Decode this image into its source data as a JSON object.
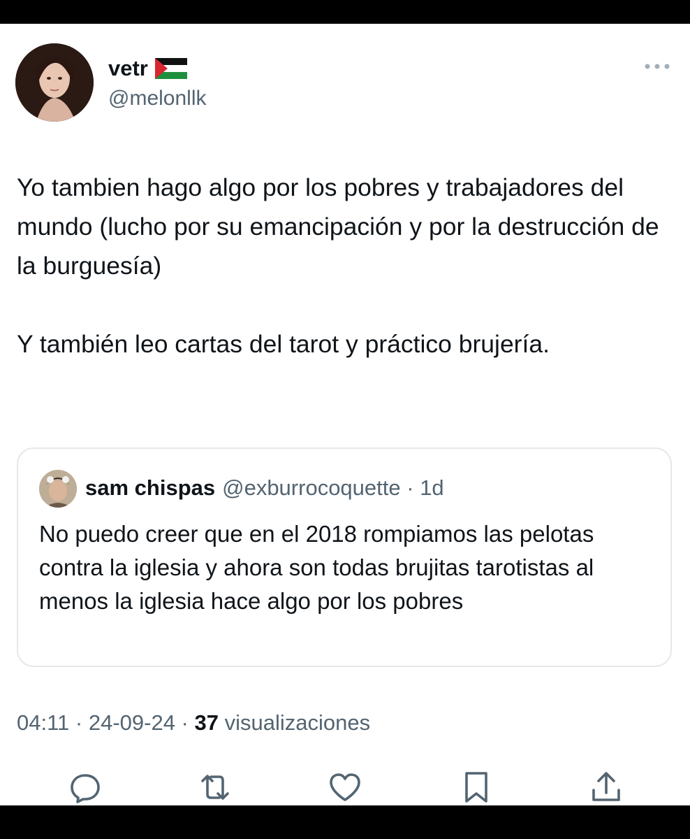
{
  "tweet": {
    "author_name": "vetr",
    "handle": "@melonllk",
    "text_paragraphs": [
      "Yo tambien hago algo por los pobres y trabajadores del mundo (lucho por su emancipación y por la destrucción de la burguesía)",
      "Y también leo cartas del tarot y práctico brujería."
    ],
    "time": "04:11",
    "date": "24-09-24",
    "views_count": "37",
    "views_label": "visualizaciones"
  },
  "quote": {
    "author_name": "sam chispas",
    "handle": "@exburrocoquette",
    "age": "1d",
    "text": "No puedo creer que en el 2018 rompiamos las pelotas contra la iglesia y ahora son todas brujitas tarotistas al menos la iglesia hace algo por los pobres"
  },
  "icons": {
    "flag": "palestine-flag-icon",
    "more": "more-options-icon",
    "actions": [
      "reply-icon",
      "retweet-icon",
      "like-icon",
      "bookmark-icon",
      "share-icon"
    ]
  },
  "colors": {
    "text_primary": "#0f1419",
    "text_secondary": "#536471",
    "border": "#e4e8eb"
  }
}
